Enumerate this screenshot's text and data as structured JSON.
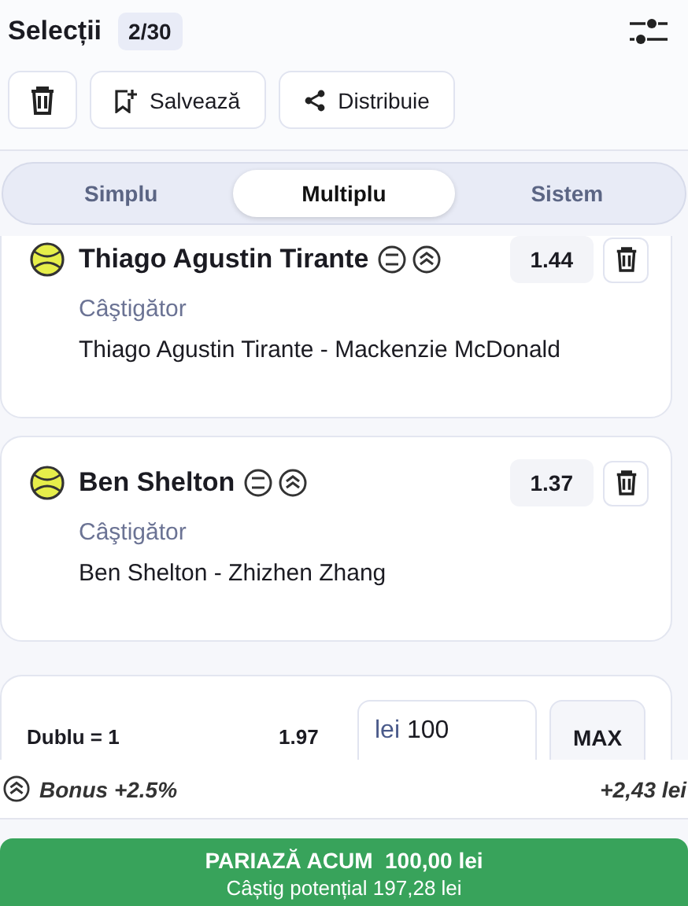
{
  "header": {
    "title": "Selecții",
    "count": "2/30"
  },
  "actions": [
    {
      "kind": "delete"
    },
    {
      "kind": "save",
      "label": "Salvează"
    },
    {
      "kind": "share",
      "label": "Distribuie"
    }
  ],
  "tabs": [
    {
      "label": "Simplu",
      "selected": false
    },
    {
      "label": "Multiplu",
      "selected": true
    },
    {
      "label": "Sistem",
      "selected": false
    }
  ],
  "selections": [
    {
      "player": "Thiago Agustin Tirante",
      "market": "Câştigător",
      "match": "Thiago Agustin Tirante - Mackenzie McDonald",
      "odds": "1.44"
    },
    {
      "player": "Ben Shelton",
      "market": "Câştigător",
      "match": "Ben Shelton - Zhizhen Zhang",
      "odds": "1.37"
    }
  ],
  "stake": {
    "label": "Dublu = 1",
    "odds": "1.97",
    "currency": "lei",
    "value": "100",
    "max": "MAX"
  },
  "bonus": {
    "label": "Bonus +2.5%",
    "amount": "+2,43 lei"
  },
  "bet_button": {
    "label": "PARIAZĂ ACUM  100,00 lei",
    "potential": "Câștig potențial 197,28 lei"
  }
}
